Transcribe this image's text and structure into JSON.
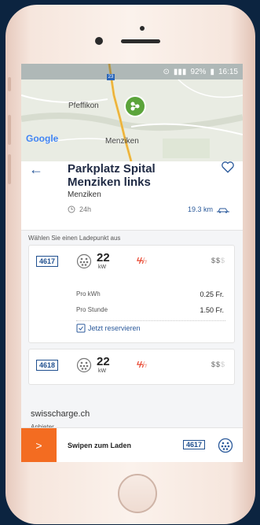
{
  "status_bar": {
    "battery": "92%",
    "time": "16:15"
  },
  "map": {
    "labels": [
      "Pfeffikon",
      "Menziken"
    ],
    "attribution": "Google",
    "route_sign": "23"
  },
  "station": {
    "name": "Parkplatz Spital Menziken links",
    "locality": "Menziken",
    "hours": "24h",
    "distance": "19.3 km"
  },
  "chargepoints": {
    "heading": "Wählen Sie einen Ladepunkt aus",
    "items": [
      {
        "id": "4617",
        "power": "22",
        "unit": "kW",
        "price_kwh_label": "Pro kWh",
        "price_kwh": "0.25 Fr.",
        "price_hour_label": "Pro Stunde",
        "price_hour": "1.50 Fr.",
        "reserve_label": "Jetzt reservieren"
      },
      {
        "id": "4618",
        "power": "22",
        "unit": "kW"
      }
    ],
    "price_level_on": "$$",
    "price_level_off": "$"
  },
  "operator": {
    "name": "swisscharge.ch",
    "sub": "Anbieter"
  },
  "swipe": {
    "label": "Swipen zum Laden",
    "chargepoint_id": "4617",
    "arrow": ">"
  },
  "colors": {
    "accent_orange": "#f36c21",
    "brand_blue": "#2b5a9b",
    "map_pin": "#5ba43b"
  },
  "icons": [
    "back-arrow-icon",
    "heart-icon",
    "clock-icon",
    "car-icon",
    "plug-icon",
    "bolt-icon",
    "reserve-icon"
  ]
}
